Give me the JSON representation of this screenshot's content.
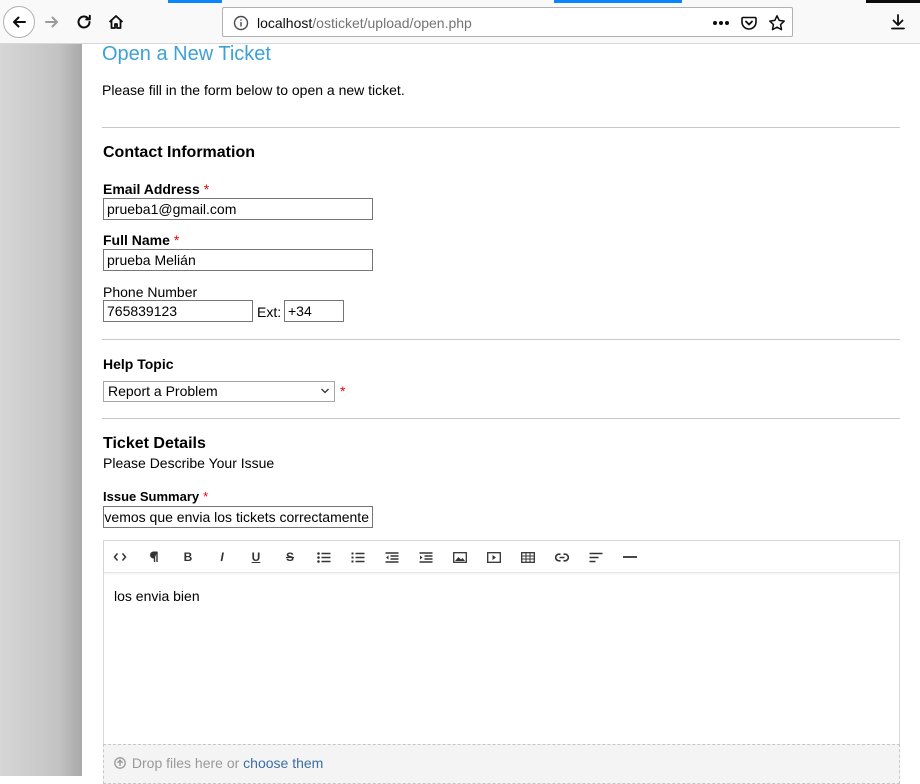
{
  "browser": {
    "url_host": "localhost",
    "url_path": "/osticket/upload/open.php"
  },
  "page": {
    "title": "Open a New Ticket",
    "intro": "Please fill in the form below to open a new ticket."
  },
  "contact": {
    "heading": "Contact Information",
    "email_label": "Email Address",
    "email_value": "prueba1@gmail.com",
    "name_label": "Full Name",
    "name_value": "prueba Melián",
    "phone_label": "Phone Number",
    "phone_value": "765839123",
    "ext_label": "Ext:",
    "ext_value": "+34",
    "required_mark": "*"
  },
  "help_topic": {
    "heading": "Help Topic",
    "selected": "Report a Problem",
    "required_mark": "*"
  },
  "details": {
    "heading": "Ticket Details",
    "subheading": "Please Describe Your Issue",
    "summary_label": "Issue Summary",
    "summary_value": "vemos que envia los tickets correctamente",
    "required_mark": "*",
    "toolbar": [
      "code-view-icon",
      "paragraph-icon",
      "bold-icon",
      "italic-icon",
      "underline-icon",
      "strikethrough-icon",
      "bullet-list-icon",
      "numbered-list-icon",
      "outdent-icon",
      "indent-icon",
      "image-icon",
      "video-icon",
      "table-icon",
      "link-icon",
      "align-icon",
      "horizontal-rule-icon"
    ],
    "body_text": "los envia bien"
  },
  "attachments": {
    "prefix": "Drop files here or",
    "link": "choose them"
  },
  "colors": {
    "title": "#3da1d8",
    "required": "#ee0000",
    "link": "#3a6ea5",
    "tab_accent": "#0a84ff"
  }
}
